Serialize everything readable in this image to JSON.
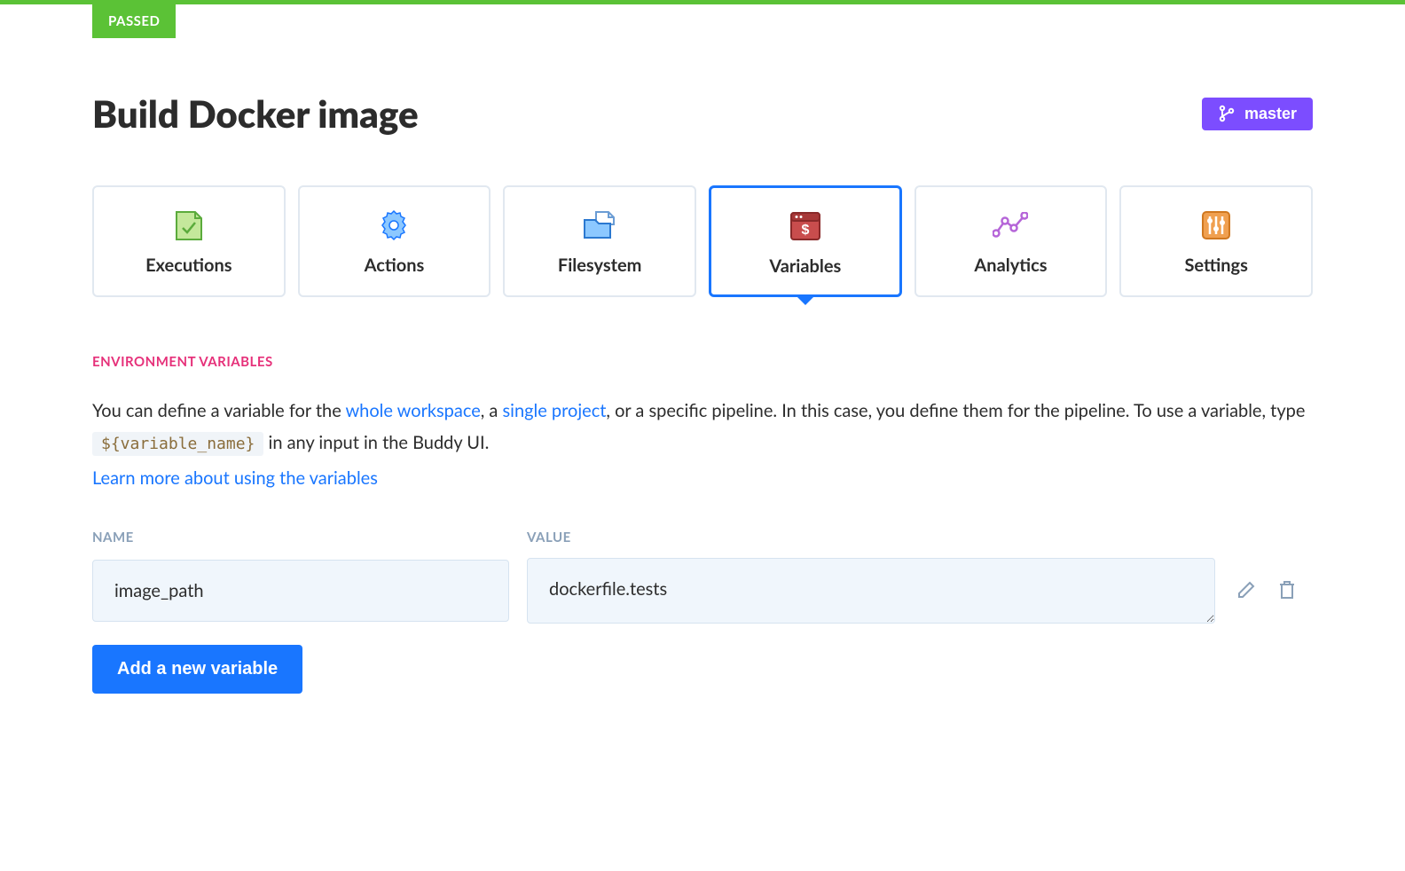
{
  "status_badge": "PASSED",
  "page_title": "Build Docker image",
  "branch_button": {
    "label": "master"
  },
  "tabs": [
    {
      "label": "Executions",
      "name": "executions",
      "active": false
    },
    {
      "label": "Actions",
      "name": "actions",
      "active": false
    },
    {
      "label": "Filesystem",
      "name": "filesystem",
      "active": false
    },
    {
      "label": "Variables",
      "name": "variables",
      "active": true
    },
    {
      "label": "Analytics",
      "name": "analytics",
      "active": false
    },
    {
      "label": "Settings",
      "name": "settings",
      "active": false
    }
  ],
  "section_label": "ENVIRONMENT VARIABLES",
  "description": {
    "part1": "You can define a variable for the ",
    "link1": "whole workspace",
    "part2": ", a ",
    "link2": "single project",
    "part3": ", or a specific pipeline. In this case, you define them for the pipeline. To use a variable, type ",
    "code": "${variable_name}",
    "part4": " in any input in the Buddy UI.",
    "learn_link": "Learn more about using the variables"
  },
  "columns": {
    "name": "NAME",
    "value": "VALUE"
  },
  "variables": [
    {
      "name": "image_path",
      "value": "dockerfile.tests"
    }
  ],
  "add_button": "Add a new variable"
}
